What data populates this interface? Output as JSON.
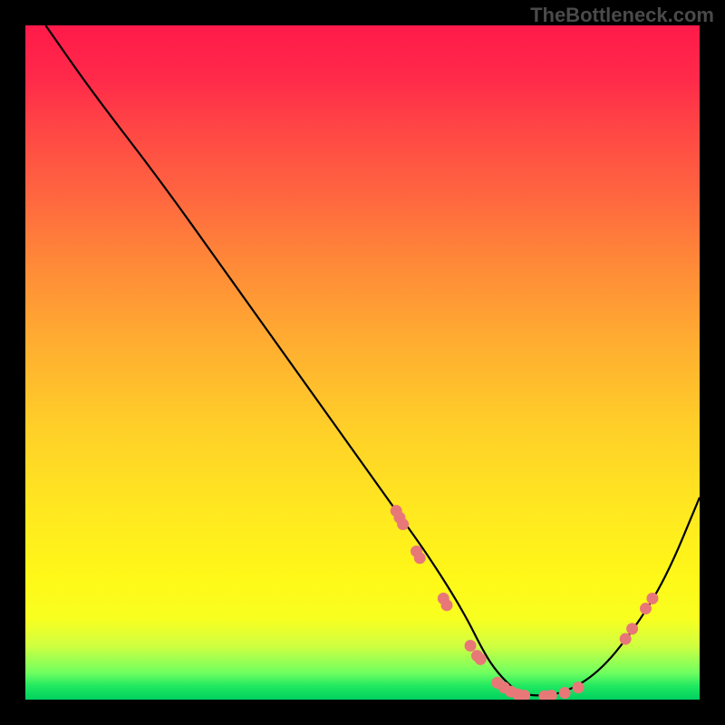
{
  "watermark": "TheBottleneck.com",
  "chart_data": {
    "type": "line",
    "title": "",
    "xlabel": "",
    "ylabel": "",
    "xlim": [
      0,
      100
    ],
    "ylim": [
      0,
      100
    ],
    "curve": {
      "name": "bottleneck-curve",
      "x": [
        3,
        10,
        20,
        30,
        40,
        50,
        55,
        60,
        65,
        68,
        70,
        73,
        76,
        80,
        85,
        90,
        95,
        100
      ],
      "y": [
        100,
        90,
        77,
        63,
        49,
        35,
        28,
        21,
        13,
        7,
        4,
        1,
        0.5,
        1,
        4,
        10,
        18,
        30
      ]
    },
    "dots": {
      "name": "data-points",
      "color": "#e87878",
      "points": [
        {
          "x": 55,
          "y": 28
        },
        {
          "x": 55.5,
          "y": 27
        },
        {
          "x": 56,
          "y": 26
        },
        {
          "x": 58,
          "y": 22
        },
        {
          "x": 58.5,
          "y": 21
        },
        {
          "x": 62,
          "y": 15
        },
        {
          "x": 62.5,
          "y": 14
        },
        {
          "x": 66,
          "y": 8
        },
        {
          "x": 67,
          "y": 6.5
        },
        {
          "x": 67.5,
          "y": 6
        },
        {
          "x": 70,
          "y": 2.5
        },
        {
          "x": 71,
          "y": 1.8
        },
        {
          "x": 72,
          "y": 1.2
        },
        {
          "x": 73,
          "y": 0.8
        },
        {
          "x": 74,
          "y": 0.6
        },
        {
          "x": 77,
          "y": 0.5
        },
        {
          "x": 78,
          "y": 0.6
        },
        {
          "x": 80,
          "y": 1
        },
        {
          "x": 82,
          "y": 1.8
        },
        {
          "x": 89,
          "y": 9
        },
        {
          "x": 90,
          "y": 10.5
        },
        {
          "x": 92,
          "y": 13.5
        },
        {
          "x": 93,
          "y": 15
        }
      ]
    }
  }
}
